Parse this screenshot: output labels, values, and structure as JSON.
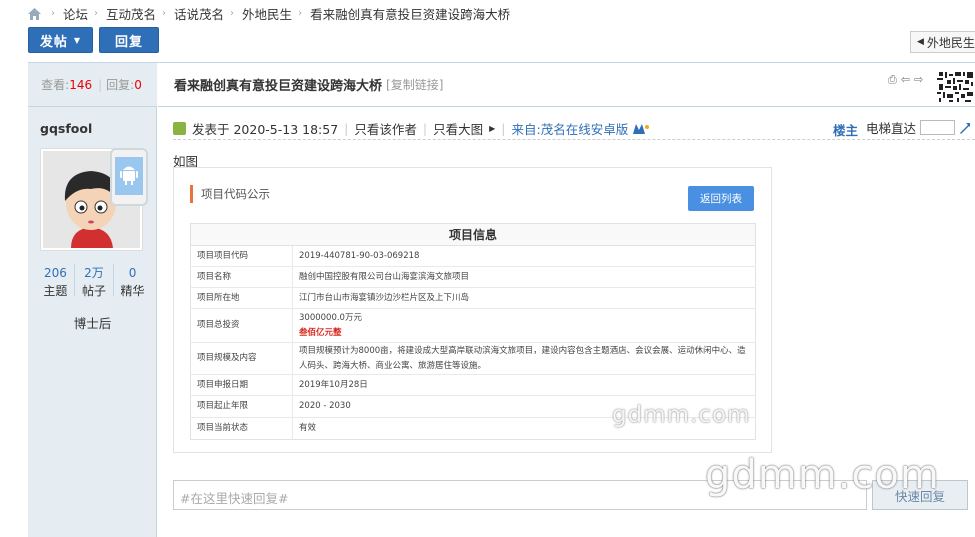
{
  "breadcrumb": {
    "items": [
      "论坛",
      "互动茂名",
      "话说茂名",
      "外地民生",
      "看来融创真有意投巨资建设跨海大桥"
    ],
    "separator": "›"
  },
  "toolbar": {
    "post_label": "发帖",
    "reply_label": "回复",
    "back_tab_label": "外地民生"
  },
  "colors": {
    "accent_blue": "#2f6fb8",
    "sidebar_bg": "#e5edf2",
    "border": "#c2d5e3",
    "red": "#e00000",
    "orange_bar": "#e8743b"
  },
  "thread": {
    "views_label": "查看:",
    "views": "146",
    "replies_label": "回复:",
    "replies": "0",
    "title": "看来融创真有意投巨资建设跨海大桥",
    "copy_link": "[复制链接]"
  },
  "author": {
    "username": "gqsfool",
    "stats": [
      {
        "num": "206",
        "label": "主题"
      },
      {
        "num": "2万",
        "label": "帖子"
      },
      {
        "num": "0",
        "label": "精华"
      }
    ],
    "rank": "博士后"
  },
  "post": {
    "posted_at": "发表于 2020-5-13 18:57",
    "only_author": "只看该作者",
    "large_image": "只看大图",
    "source": "来自:茂名在线安卓版",
    "floor": "楼主",
    "elevator": "电梯直达",
    "body_text": "如图"
  },
  "project_image": {
    "header": "项目代码公示",
    "back_button": "返回列表",
    "table_title": "项目信息",
    "rows": [
      {
        "k": "项目项目代码",
        "v": "2019-440781-90-03-069218"
      },
      {
        "k": "项目名称",
        "v": "融创中国控股有限公司台山海宴滨海文旅项目"
      },
      {
        "k": "项目所在地",
        "v": "江门市台山市海宴镇沙边沙栏片区及上下川岛"
      },
      {
        "k": "项目总投资",
        "v": "3000000.0万元",
        "v2": "叁佰亿元整"
      },
      {
        "k": "项目规模及内容",
        "v": "项目规模预计为8000亩，将建设成大型高岸联动滨海文旅项目，建设内容包含主题酒店、会议会展、运动休闲中心、造人码头、跨海大桥、商业公寓、旅游居住等设施。"
      },
      {
        "k": "项目申报日期",
        "v": "2019年10月28日"
      },
      {
        "k": "项目起止年限",
        "v": "2020 - 2030"
      },
      {
        "k": "项目当前状态",
        "v": "有效"
      }
    ]
  },
  "watermark": {
    "small": "gdmm.com",
    "large": "gdmm.com"
  },
  "quick_reply": {
    "placeholder": "#在这里快速回复#",
    "button": "快速回复"
  }
}
